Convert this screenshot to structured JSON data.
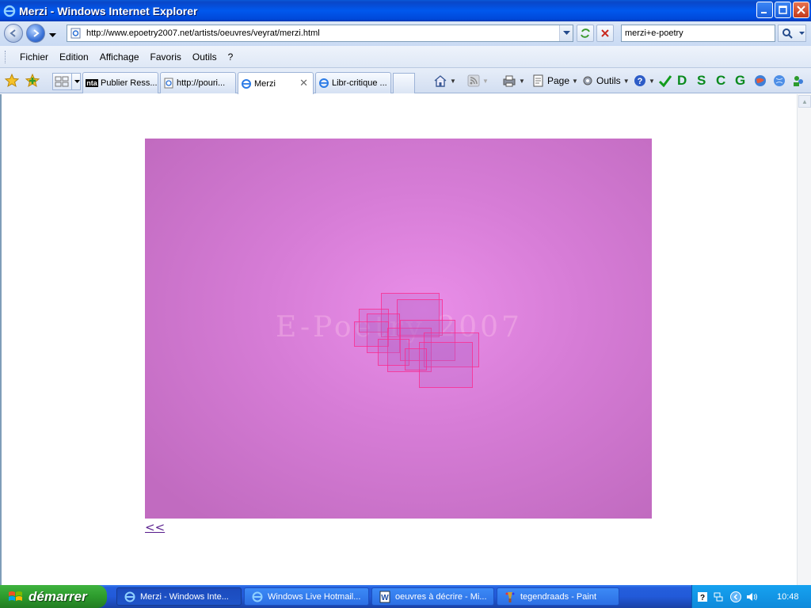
{
  "window": {
    "title": "Merzi - Windows Internet Explorer"
  },
  "address_bar": {
    "url": "http://www.epoetry2007.net/artists/oeuvres/veyrat/merzi.html"
  },
  "search": {
    "value": "merzi+e-poetry"
  },
  "menu": {
    "items": [
      "Fichier",
      "Edition",
      "Affichage",
      "Favoris",
      "Outils",
      "?"
    ]
  },
  "tabs": [
    {
      "label": "Publier Ress..."
    },
    {
      "label": "http://pouri..."
    },
    {
      "label": "Merzi"
    },
    {
      "label": "Libr-critique ..."
    }
  ],
  "command_bar": {
    "page_label": "Page",
    "tools_label": "Outils",
    "letters": [
      "D",
      "S",
      "C",
      "G"
    ]
  },
  "content": {
    "watermark": "E-Poetry 2007",
    "back_link": "<<"
  },
  "taskbar": {
    "start_label": "démarrer",
    "tasks": [
      {
        "label": "Merzi - Windows Inte..."
      },
      {
        "label": "Windows Live Hotmail..."
      },
      {
        "label": "oeuvres à décrire - Mi..."
      },
      {
        "label": "tegendraads - Paint"
      }
    ],
    "clock": "10:48"
  },
  "colors": {
    "stage_center": "#e98ee8",
    "stage_edge": "#c16bc0",
    "titlebar": "#0058ee",
    "start_button": "#2d9b2d"
  }
}
